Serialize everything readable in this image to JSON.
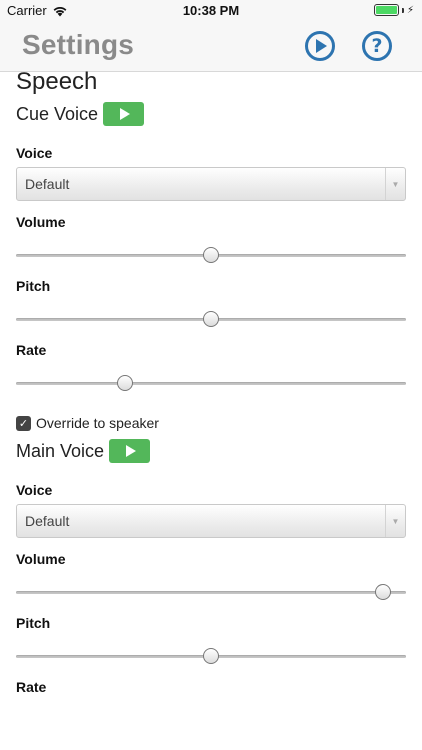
{
  "status": {
    "carrier": "Carrier",
    "time": "10:38 PM",
    "battery_level": 1.0
  },
  "nav": {
    "title": "Settings"
  },
  "section": {
    "title": "Speech"
  },
  "cue_voice": {
    "title": "Cue Voice",
    "voice_label": "Voice",
    "voice_value": "Default",
    "volume_label": "Volume",
    "volume_level": 0.5,
    "pitch_label": "Pitch",
    "pitch_level": 0.5,
    "rate_label": "Rate",
    "rate_level": 0.28
  },
  "override": {
    "label": "Override to speaker",
    "checked": true
  },
  "main_voice": {
    "title": "Main Voice",
    "voice_label": "Voice",
    "voice_value": "Default",
    "volume_label": "Volume",
    "volume_level": 0.94,
    "pitch_label": "Pitch",
    "pitch_level": 0.5,
    "rate_label": "Rate"
  },
  "colors": {
    "accent": "#2d74b0",
    "play_button": "#53b75a",
    "nav_title": "#8a8a8a"
  }
}
